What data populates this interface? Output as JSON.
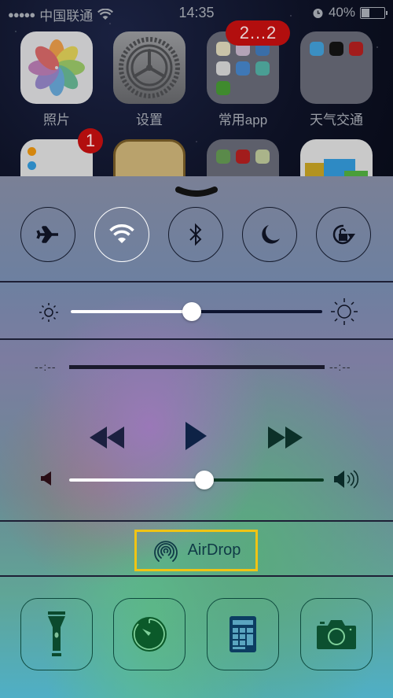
{
  "status_bar": {
    "signal": "●●●●●",
    "carrier": "中国联通",
    "time": "14:35",
    "battery_percent": "40%",
    "battery_level": 0.4,
    "icons": [
      "signal-dots-icon",
      "wifi-icon",
      "alarm-icon",
      "battery-icon"
    ]
  },
  "home_screen": {
    "apps": [
      {
        "label": "照片",
        "icon": "photos-icon"
      },
      {
        "label": "设置",
        "icon": "settings-icon"
      },
      {
        "label": "常用app",
        "icon": "folder-icon",
        "badge": "2…2"
      },
      {
        "label": "天气交通",
        "icon": "folder-icon"
      },
      {
        "label": "",
        "icon": "reminders-icon",
        "badge": "1"
      },
      {
        "label": "",
        "icon": "voice-memos-icon"
      },
      {
        "label": "",
        "icon": "maps-folder-icon"
      },
      {
        "label": "",
        "icon": "newsstand-icon"
      }
    ]
  },
  "control_center": {
    "toggles": [
      {
        "name": "airplane-mode",
        "icon": "airplane-icon",
        "on": false
      },
      {
        "name": "wifi",
        "icon": "wifi-icon",
        "on": true
      },
      {
        "name": "bluetooth",
        "icon": "bluetooth-icon",
        "on": false
      },
      {
        "name": "do-not-disturb",
        "icon": "moon-icon",
        "on": false
      },
      {
        "name": "rotation-lock",
        "icon": "rotation-lock-icon",
        "on": false
      }
    ],
    "brightness": {
      "value": 0.48,
      "min_icon": "sun-small-icon",
      "max_icon": "sun-large-icon"
    },
    "music": {
      "elapsed": "--:--",
      "remaining": "--:--",
      "controls": [
        "rewind-icon",
        "play-icon",
        "fast-forward-icon"
      ]
    },
    "volume": {
      "value": 0.53,
      "min_icon": "speaker-low-icon",
      "max_icon": "speaker-high-icon"
    },
    "airdrop": {
      "label": "AirDrop",
      "icon": "airdrop-icon",
      "highlight_color": "#f0c414"
    },
    "quick_launch": [
      {
        "name": "flashlight",
        "icon": "flashlight-icon"
      },
      {
        "name": "timer",
        "icon": "timer-icon"
      },
      {
        "name": "calculator",
        "icon": "calculator-icon"
      },
      {
        "name": "camera",
        "icon": "camera-icon"
      }
    ]
  }
}
